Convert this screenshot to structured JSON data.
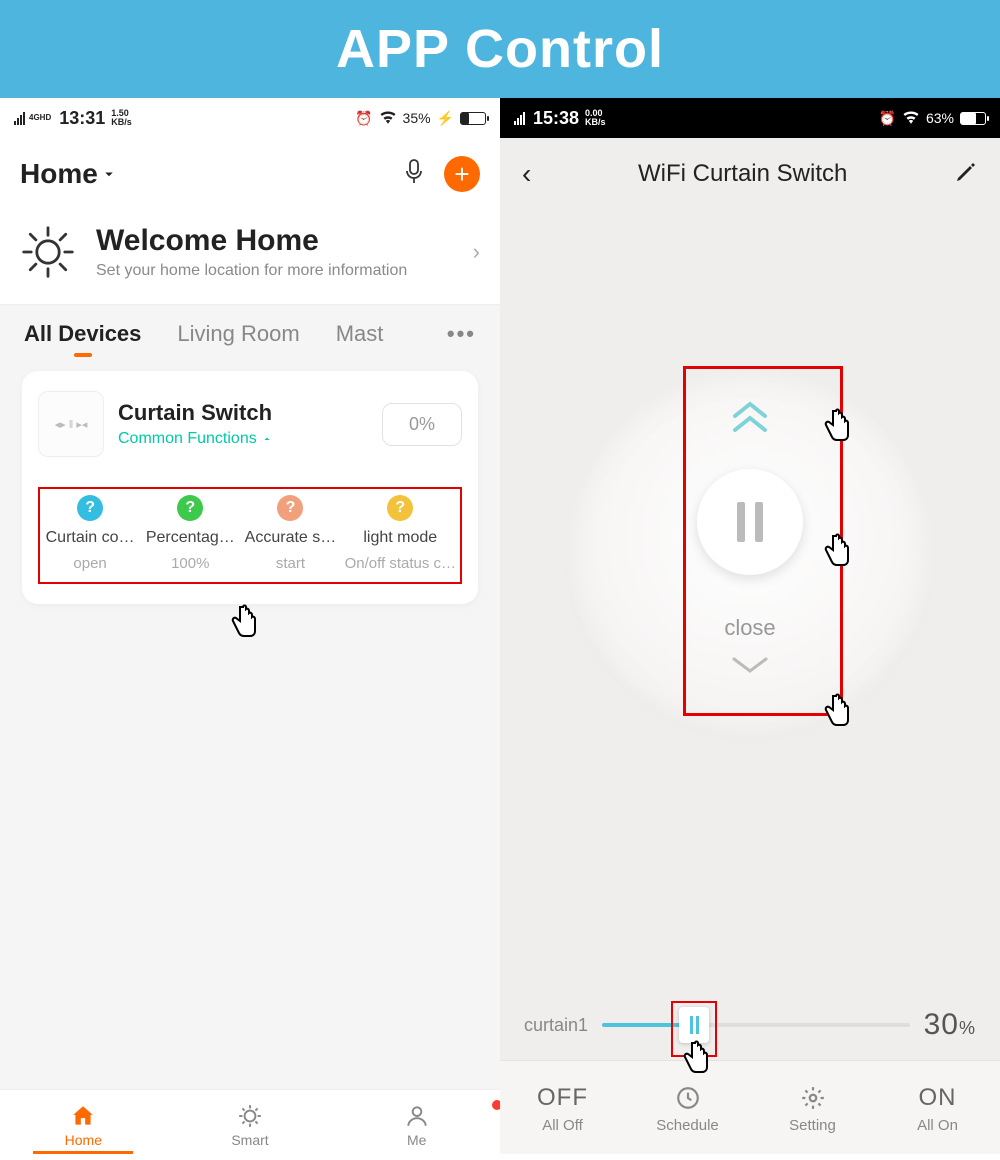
{
  "banner": "APP Control",
  "left": {
    "status": {
      "net": "4GHD",
      "time": "13:31",
      "speed": "1.50",
      "speed_unit": "KB/s",
      "battery_pct": "35%",
      "charging": "⚡"
    },
    "header": {
      "home": "Home"
    },
    "welcome": {
      "title": "Welcome Home",
      "subtitle": "Set your home location for more information"
    },
    "tabs": [
      "All Devices",
      "Living Room",
      "Mast"
    ],
    "device": {
      "name": "Curtain Switch",
      "common": "Common Functions",
      "pct": "0%"
    },
    "functions": [
      {
        "title": "Curtain co…",
        "sub": "open",
        "color": "#33bde0"
      },
      {
        "title": "Percentag…",
        "sub": "100%",
        "color": "#3cc94c"
      },
      {
        "title": "Accurate s…",
        "sub": "start",
        "color": "#f2a07c"
      },
      {
        "title": "light mode",
        "sub": "On/off status c…",
        "color": "#f2c23a"
      }
    ],
    "nav": [
      "Home",
      "Smart",
      "Me"
    ]
  },
  "right": {
    "status": {
      "time": "15:38",
      "speed": "0.00",
      "speed_unit": "KB/s",
      "battery_pct": "63%"
    },
    "title": "WiFi Curtain Switch",
    "close_label": "close",
    "slider": {
      "label": "curtain1",
      "pct": "30",
      "pct_pos": 30
    },
    "tabs": [
      {
        "big": "OFF",
        "sm": "All Off"
      },
      {
        "big": "clock-icon",
        "sm": "Schedule"
      },
      {
        "big": "gear-icon",
        "sm": "Setting"
      },
      {
        "big": "ON",
        "sm": "All On"
      }
    ]
  }
}
